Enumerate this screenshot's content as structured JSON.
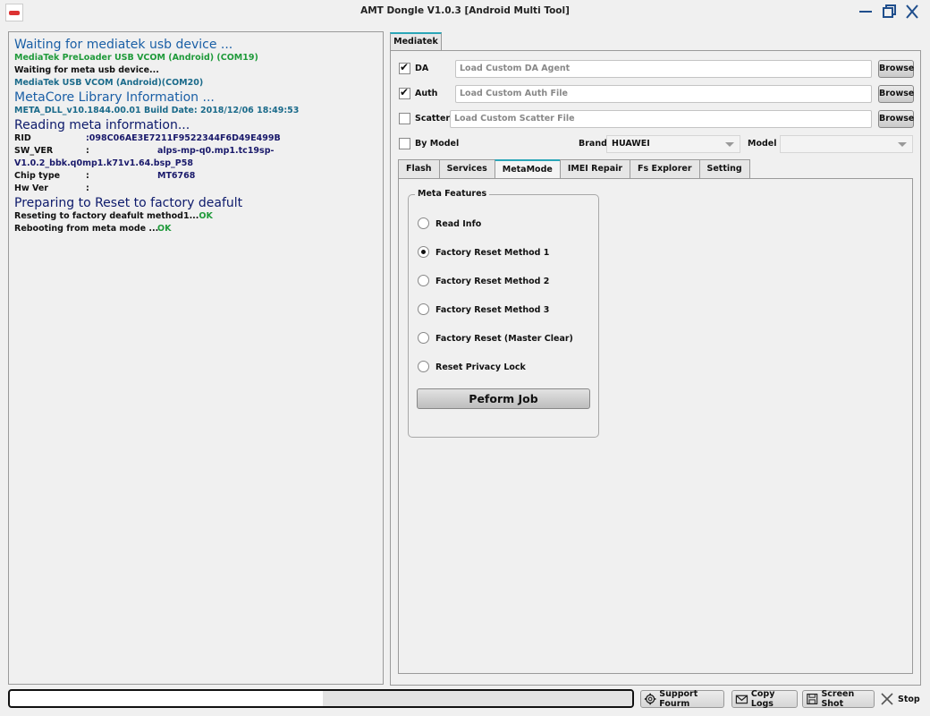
{
  "window": {
    "title": "AMT Dongle V1.0.3 [Android Multi Tool]"
  },
  "log": {
    "line1": "Waiting for mediatek usb device ...",
    "line2": "MediaTek PreLoader USB VCOM (Android) (COM19)",
    "line3": "Waiting for meta usb device...",
    "line4": "MediaTek USB VCOM (Android)(COM20)",
    "line5": "MetaCore Library Information ...",
    "line6": "META_DLL_v10.1844.00.01 Build Date: 2018/12/06 18:49:53",
    "line7": "Reading meta information...",
    "rid_key": "RID",
    "rid_value": ":098C06AE3E7211F9522344F6D49E499B",
    "swver_key": "SW_VER",
    "swver_sep": ":",
    "swver_value": "alps-mp-q0.mp1.tc19sp-",
    "swver_cont": "V1.0.2_bbk.q0mp1.k71v1.64.bsp_P58",
    "chip_key": "Chip type",
    "chip_sep": ":",
    "chip_value": "MT6768",
    "hw_key": "Hw Ver",
    "hw_sep": ":",
    "line8": "Preparing to Reset to factory deafult",
    "line9_text": "Reseting to factory deafult method1...",
    "line9_status": "OK",
    "line10_text": "Rebooting from meta mode ...",
    "line10_status": "OK"
  },
  "main_tab": "Mediatek",
  "options": {
    "da_label": "DA",
    "da_checked": true,
    "da_placeholder": "Load Custom DA Agent",
    "auth_label": "Auth",
    "auth_checked": true,
    "auth_placeholder": "Load Custom Auth File",
    "scatter_label": "Scatter",
    "scatter_checked": false,
    "scatter_placeholder": "Load Custom Scatter File",
    "browse_label": "Browse",
    "bymodel_label": "By Model",
    "bymodel_checked": false,
    "brand_label": "Brand",
    "brand_value": "HUAWEI",
    "model_label": "Model",
    "model_value": ""
  },
  "tabs": [
    "Flash",
    "Services",
    "MetaMode",
    "IMEI Repair",
    "Fs Explorer",
    "Setting"
  ],
  "active_tab": "MetaMode",
  "meta": {
    "group_title": "Meta Features",
    "options": [
      "Read Info",
      "Factory Reset Method 1",
      "Factory Reset Method 2",
      "Factory Reset Method 3",
      "Factory Reset (Master Clear)",
      "Reset Privacy Lock"
    ],
    "selected": "Factory Reset Method 1",
    "perform_label": "Peform Job"
  },
  "footer": {
    "progress": 0.5,
    "support_label": "Support Fourm",
    "copy_label": "Copy Logs",
    "screenshot_label": "Screen Shot",
    "stop_label": "Stop"
  },
  "icons": [
    "app-icon",
    "minimize-icon",
    "maximize-icon",
    "close-icon",
    "gear-icon",
    "mail-icon",
    "save-icon",
    "stop-icon"
  ]
}
